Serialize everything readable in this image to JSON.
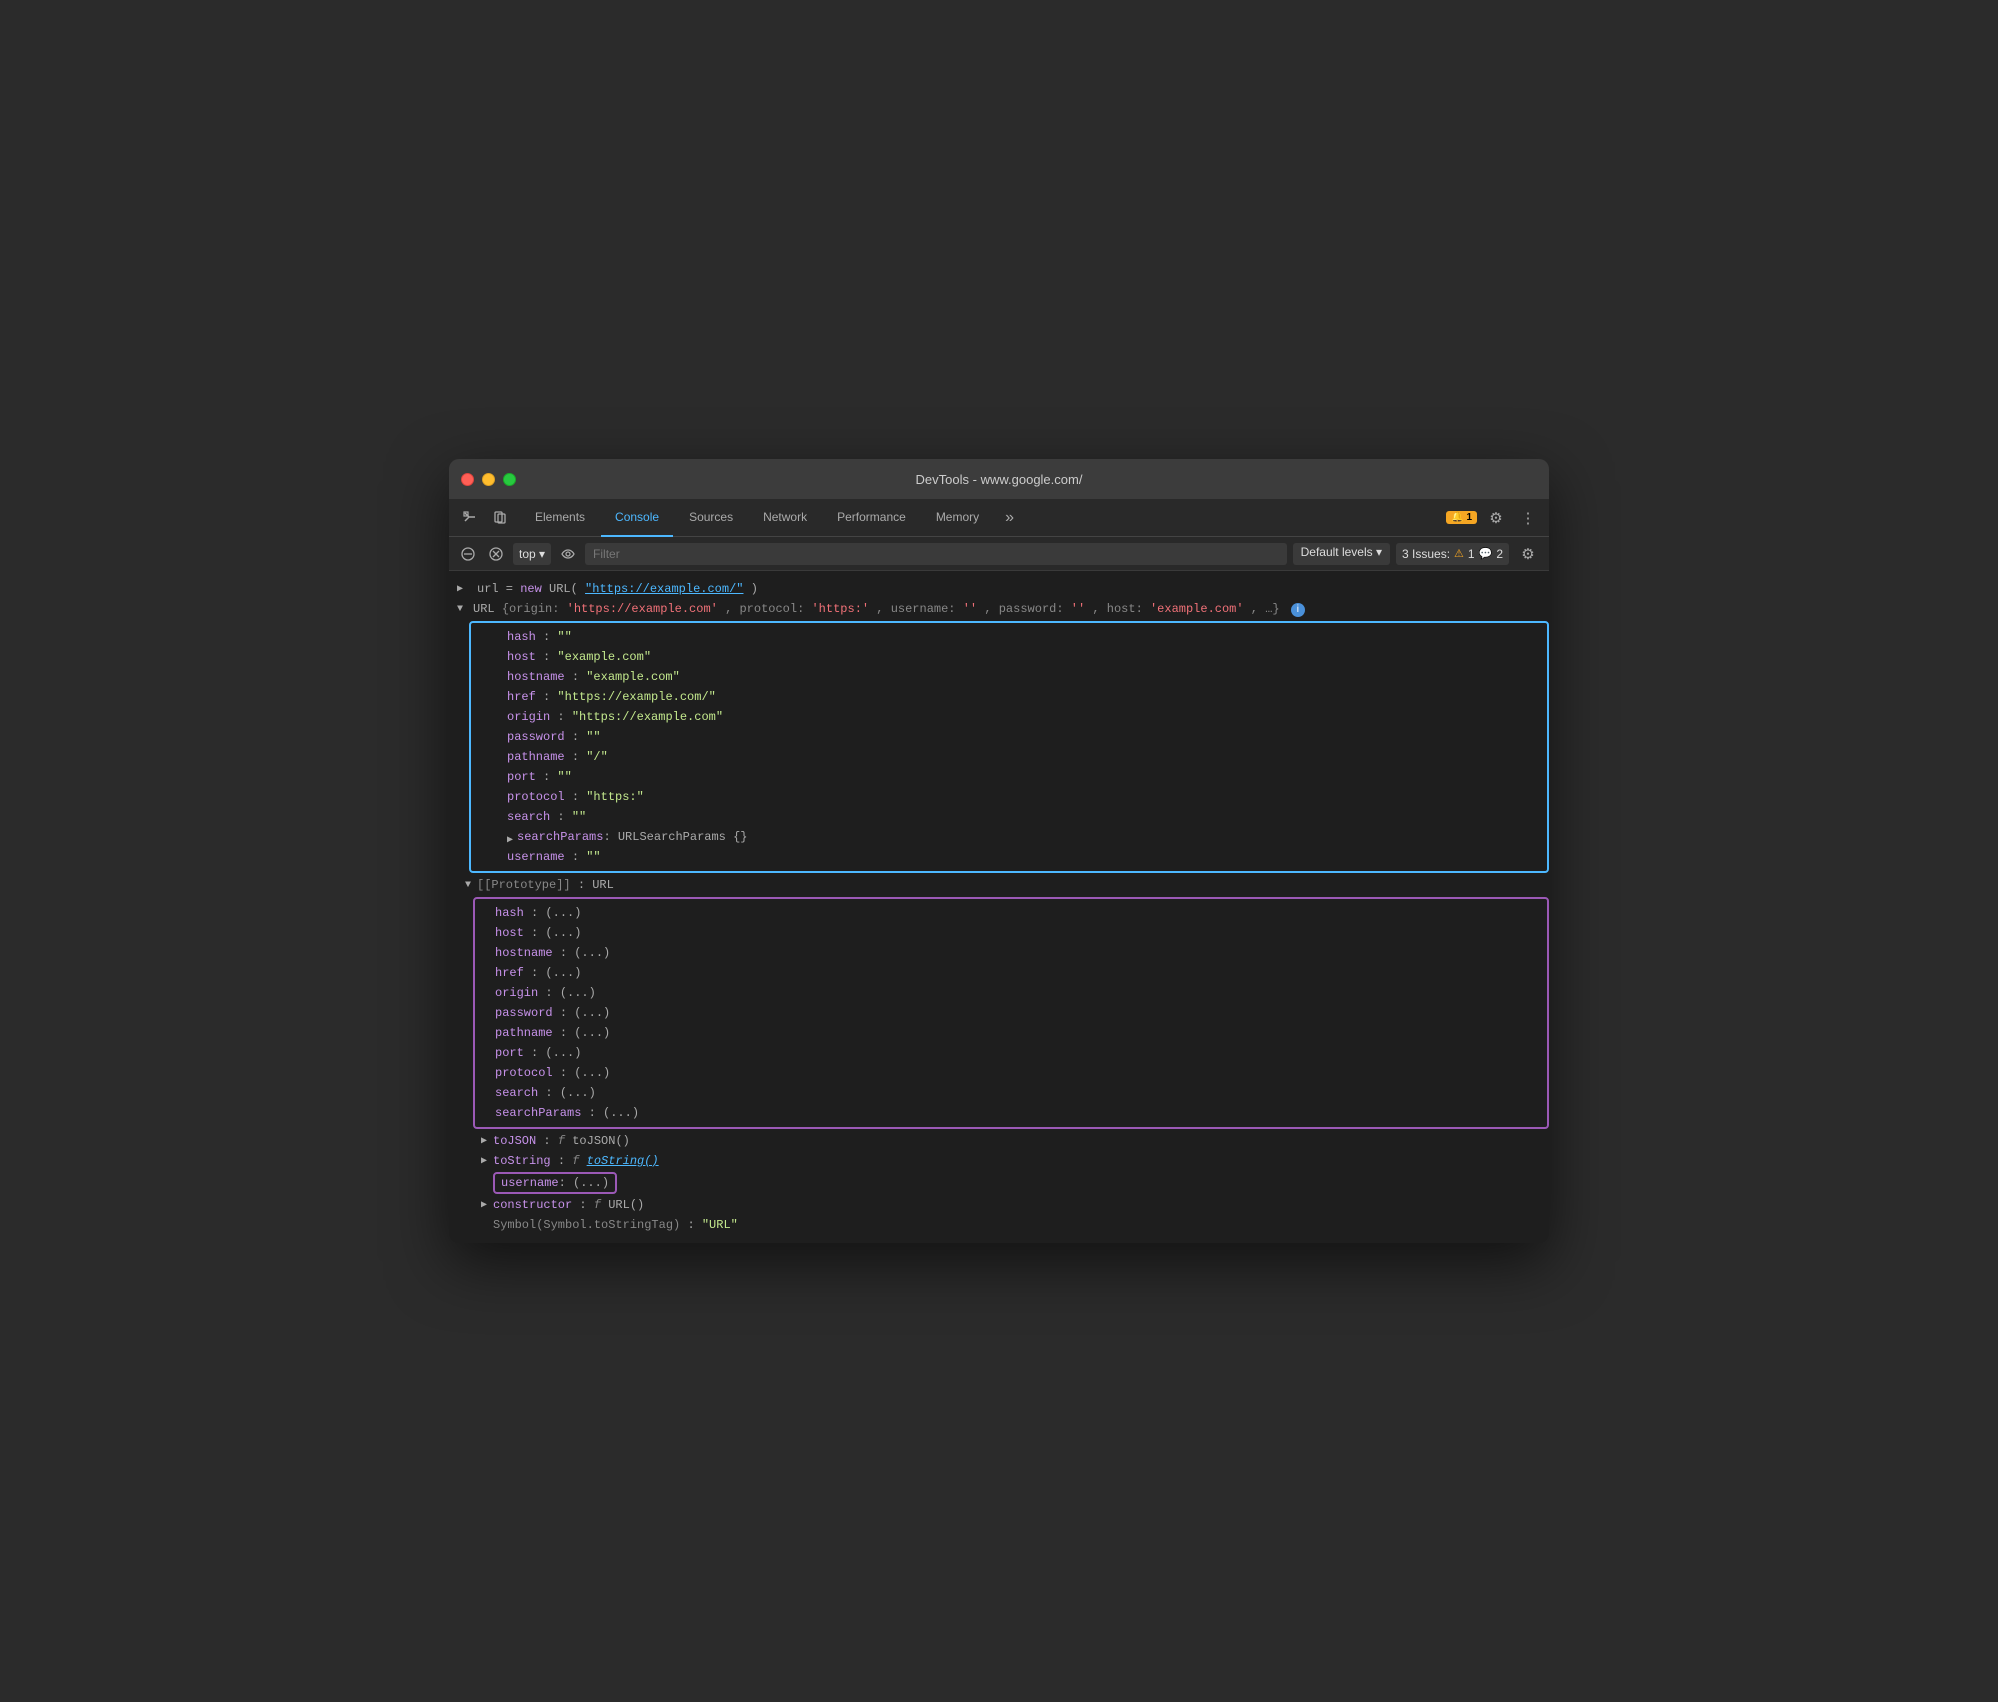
{
  "window": {
    "title": "DevTools - www.google.com/"
  },
  "traffic_lights": {
    "red": "close",
    "yellow": "minimize",
    "green": "maximize"
  },
  "tabs": [
    {
      "label": "Elements",
      "active": false
    },
    {
      "label": "Console",
      "active": true
    },
    {
      "label": "Sources",
      "active": false
    },
    {
      "label": "Network",
      "active": false
    },
    {
      "label": "Performance",
      "active": false
    },
    {
      "label": "Memory",
      "active": false
    }
  ],
  "toolbar": {
    "top_label": "top ▾",
    "filter_placeholder": "Filter",
    "levels_label": "Default levels ▾",
    "issues_label": "3 Issues:",
    "issues_warn_count": "1",
    "issues_info_count": "2"
  },
  "console": {
    "line1": "url = new URL(\"https://example.com/\")",
    "url_object_header": "▼ URL {origin: 'https://example.com', protocol: 'https:', username: '', password: '', host: 'example.com', …}",
    "properties": {
      "hash": "\"\"",
      "host": "\"example.com\"",
      "hostname": "\"example.com\"",
      "href": "\"https://example.com/\"",
      "origin": "\"https://example.com\"",
      "password": "\"\"",
      "pathname": "\"/\"",
      "port": "\"\"",
      "protocol": "\"https:\"",
      "search": "\"\""
    },
    "prototype_header": "▼ [[Prototype]]: URL",
    "prototype_props": {
      "hash": "(...)",
      "host": "(...)",
      "hostname": "(...)",
      "href": "(...)",
      "origin": "(...)",
      "password": "(...)",
      "pathname": "(...)",
      "port": "(...)",
      "protocol": "(...)",
      "search": "(...)",
      "searchParams": "(...)"
    },
    "toJSON": "f toJSON()",
    "toString": "f toString()",
    "username_highlight": "username: (...)",
    "constructor": "f URL()",
    "symbol": "\"URL\""
  }
}
